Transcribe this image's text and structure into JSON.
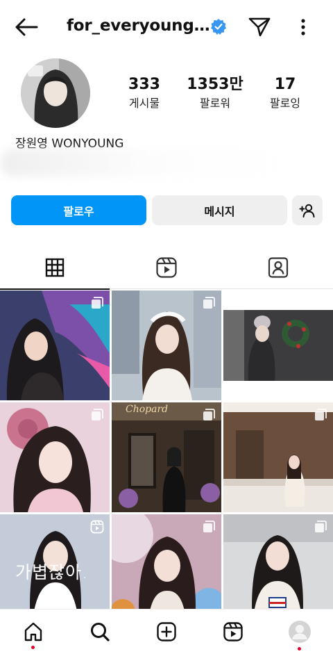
{
  "header": {
    "handle": "for_everyoung…",
    "icons": {
      "back": "back-arrow-icon",
      "verified": "verified-badge-icon",
      "dm": "direct-message-icon",
      "more": "more-options-icon"
    }
  },
  "profile": {
    "name": "장원영 WONYOUNG",
    "stats": [
      {
        "value": "333",
        "label": "게시물"
      },
      {
        "value": "1353만",
        "label": "팔로워"
      },
      {
        "value": "17",
        "label": "팔로잉"
      }
    ]
  },
  "actions": {
    "follow": "팔로우",
    "message": "메시지",
    "suggest_icon": "add-person-icon"
  },
  "tabs": [
    {
      "name": "grid",
      "icon": "grid-icon",
      "active": true
    },
    {
      "name": "reels",
      "icon": "reels-icon",
      "active": false
    },
    {
      "name": "tagged",
      "icon": "tagged-person-icon",
      "active": false
    }
  ],
  "grid": {
    "caption_text": "가볍잖아.",
    "brand_text": "Chopard",
    "badges": [
      "carousel-icon",
      "carousel-icon",
      "carousel-icon",
      "carousel-icon",
      "carousel-icon",
      "carousel-icon",
      "reels-icon",
      "carousel-icon",
      "carousel-icon"
    ]
  },
  "bottom_nav": [
    {
      "name": "home",
      "icon": "home-icon"
    },
    {
      "name": "search",
      "icon": "search-icon"
    },
    {
      "name": "create",
      "icon": "create-plus-icon"
    },
    {
      "name": "reels",
      "icon": "reels-icon"
    },
    {
      "name": "profile",
      "icon": "profile-avatar-icon"
    }
  ],
  "colors": {
    "accent": "#0095f6",
    "secondary_button": "#efefef",
    "notification_dot": "#e4002b"
  }
}
